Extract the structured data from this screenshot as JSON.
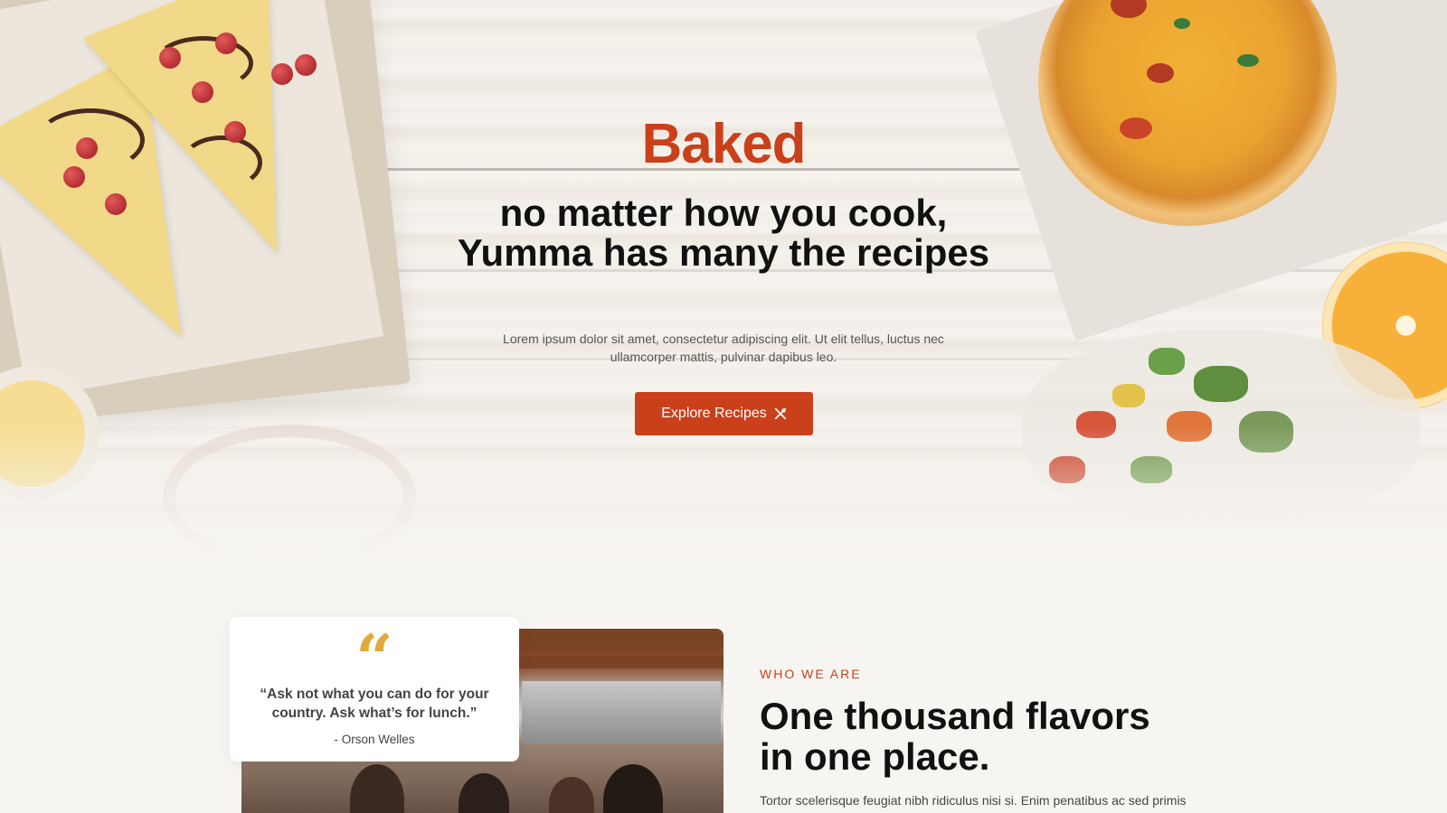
{
  "hero": {
    "brand": "Baked",
    "headline": "no matter how you cook, Yumma has many the recipes",
    "subtext": "Lorem ipsum dolor sit amet, consectetur adipiscing elit. Ut elit tellus, luctus nec ullamcorper mattis, pulvinar dapibus leo.",
    "cta_label": "Explore Recipes",
    "cta_icon": "utensils-icon"
  },
  "quote": {
    "mark": "“",
    "text": "“Ask not what you can do for your country. Ask what’s for lunch.”",
    "author": "- Orson Welles"
  },
  "about": {
    "eyebrow": "WHO WE ARE",
    "title": "One thousand flavors in one place.",
    "body": "Tortor scelerisque feugiat nibh ridiculus nisi si. Enim penatibus ac sed primis"
  },
  "colors": {
    "accent": "#c9401b",
    "quote_mark": "#e0a93a",
    "background": "#f7f5f2"
  }
}
